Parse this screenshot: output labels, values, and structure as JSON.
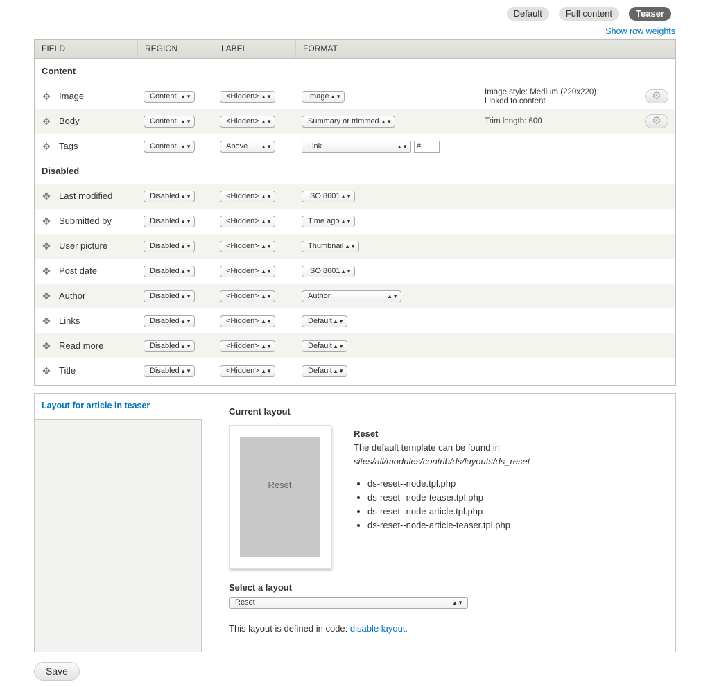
{
  "view_modes": {
    "tab1": "Default",
    "tab2": "Full content",
    "tab3": "Teaser"
  },
  "show_row_weights": "Show row weights",
  "table": {
    "headers": {
      "field": "FIELD",
      "region": "REGION",
      "label": "LABEL",
      "format": "FORMAT"
    },
    "regions": {
      "content": "Content",
      "disabled": "Disabled"
    },
    "rows": [
      {
        "name": "Image",
        "region": "Content",
        "label": "<Hidden>",
        "format": "Image",
        "summary": "Image style: Medium (220x220)",
        "summary2": "Linked to content"
      },
      {
        "name": "Body",
        "region": "Content",
        "label": "<Hidden>",
        "format": "Summary or trimmed",
        "summary": "Trim length: 600"
      },
      {
        "name": "Tags",
        "region": "Content",
        "label": "Above",
        "format": "Link",
        "extra": "#"
      },
      {
        "name": "Last modified",
        "region": "Disabled",
        "label": "<Hidden>",
        "format": "ISO 8601"
      },
      {
        "name": "Submitted by",
        "region": "Disabled",
        "label": "<Hidden>",
        "format": "Time ago"
      },
      {
        "name": "User picture",
        "region": "Disabled",
        "label": "<Hidden>",
        "format": "Thumbnail"
      },
      {
        "name": "Post date",
        "region": "Disabled",
        "label": "<Hidden>",
        "format": "ISO 8601"
      },
      {
        "name": "Author",
        "region": "Disabled",
        "label": "<Hidden>",
        "format": "Author"
      },
      {
        "name": "Links",
        "region": "Disabled",
        "label": "<Hidden>",
        "format": "Default"
      },
      {
        "name": "Read more",
        "region": "Disabled",
        "label": "<Hidden>",
        "format": "Default"
      },
      {
        "name": "Title",
        "region": "Disabled",
        "label": "<Hidden>",
        "format": "Default"
      }
    ]
  },
  "layout": {
    "tab_label": "Layout for article in teaser",
    "current_title": "Current layout",
    "thumb_label": "Reset",
    "reset_title": "Reset",
    "template_text": "The default template can be found in",
    "template_path": "sites/all/modules/contrib/ds/layouts/ds_reset",
    "files": [
      "ds-reset--node.tpl.php",
      "ds-reset--node-teaser.tpl.php",
      "ds-reset--node-article.tpl.php",
      "ds-reset--node-article-teaser.tpl.php"
    ],
    "select_title": "Select a layout",
    "select_value": "Reset",
    "defined_text": "This layout is defined in code:",
    "disable_link": "disable layout."
  },
  "save_label": "Save"
}
